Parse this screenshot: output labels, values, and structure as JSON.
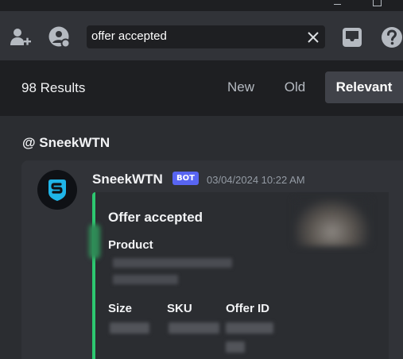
{
  "search": {
    "query": "offer accepted"
  },
  "results": {
    "count_label": "98 Results",
    "sort_tabs": [
      {
        "label": "New",
        "active": false
      },
      {
        "label": "Old",
        "active": false
      },
      {
        "label": "Relevant",
        "active": true
      }
    ]
  },
  "channel": {
    "label": "@ SneekWTN"
  },
  "message": {
    "author": "SneekWTN",
    "badge": "BOT",
    "timestamp": "03/04/2024 10:22 AM",
    "embed": {
      "title": "Offer accepted",
      "accent_color": "#2dc770",
      "fields": {
        "product": "Product",
        "size": "Size",
        "sku": "SKU",
        "offer_id": "Offer ID"
      }
    }
  },
  "colors": {
    "bot_badge": "#5865f2",
    "active_tab_bg": "#404249",
    "avatar_logo": "#1fb5e8"
  },
  "icons": [
    "add-friend-icon",
    "profile-icon",
    "close-icon",
    "inbox-icon",
    "help-icon",
    "minimize-icon",
    "maximize-icon"
  ]
}
